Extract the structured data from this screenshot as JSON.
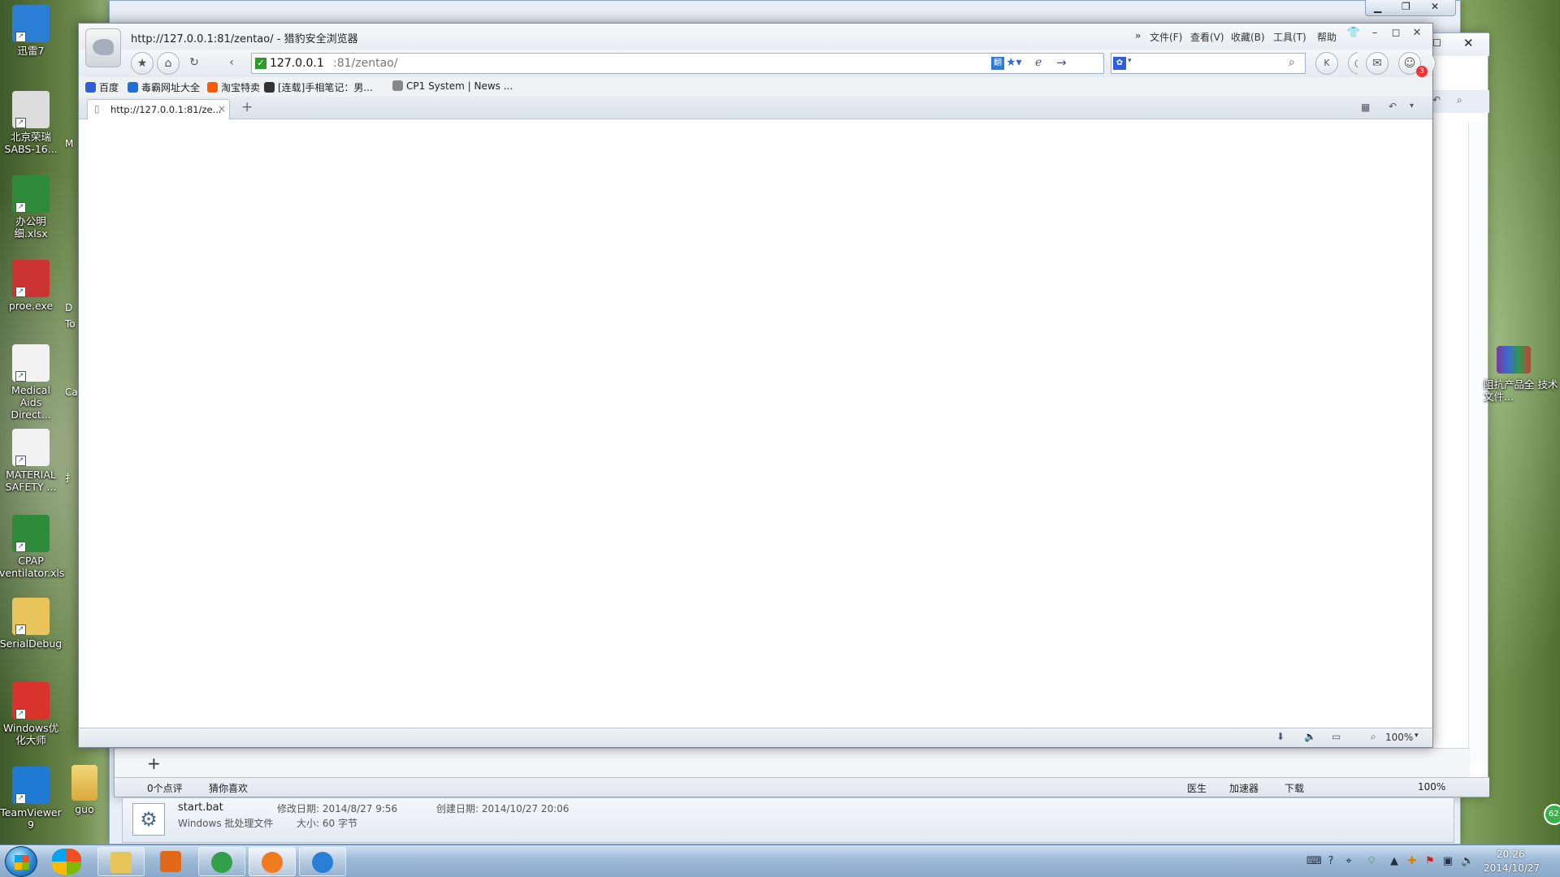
{
  "desktop": {
    "icons": [
      {
        "label": "迅雷7",
        "icon": "thunder-bird-icon",
        "color": "#2a7fd4"
      },
      {
        "label": "北京荣瑞 SABS-16...",
        "icon": "device-doc-icon",
        "color": "#ddd"
      },
      {
        "label": "办公明细.xlsx",
        "icon": "excel-file-icon",
        "color": "#2e8b3a"
      },
      {
        "label": "proe.exe",
        "icon": "proe-app-icon",
        "color": "#c33"
      },
      {
        "label": "Medical Aids Direct...",
        "icon": "pdf-document-icon",
        "color": "#f2f2f2"
      },
      {
        "label": "MATERIAL SAFETY ...",
        "icon": "pdf-document-icon",
        "color": "#f2f2f2"
      },
      {
        "label": "CPAP ventilator.xls",
        "icon": "excel-file-icon",
        "color": "#2e8b3a"
      },
      {
        "label": "SerialDebug",
        "icon": "folder-icon",
        "color": "#e8c45a"
      },
      {
        "label": "Windows优化大师",
        "icon": "windows-optimizer-icon",
        "color": "#d9332b"
      },
      {
        "label": "TeamViewer 9",
        "icon": "teamviewer-icon",
        "color": "#1f7bd4"
      }
    ],
    "partial_labels": [
      "M",
      "D",
      "To",
      "Ca",
      "扌"
    ],
    "guo_label": "guo",
    "right_icon_label": "阻抗产品全 技术文件..."
  },
  "browser": {
    "window_title": "http://127.0.0.1:81/zentao/ - 猎豹安全浏览器",
    "menu": [
      "文件(F)",
      "查看(V)",
      "收藏(B)",
      "工具(T)",
      "帮助"
    ],
    "menu_chevron": "»",
    "address_host": "127.0.0.1",
    "address_rest": ":81/zentao/",
    "favorites": [
      {
        "label": "百度",
        "icon": "baidu-paw-icon",
        "color": "#2e5fd8"
      },
      {
        "label": "毒霸网址大全",
        "icon": "k-circle-icon",
        "color": "#1e6fd6"
      },
      {
        "label": "淘宝特卖",
        "icon": "taobao-icon",
        "color": "#ff5a00"
      },
      {
        "label": "[连载]手相笔记：男...",
        "icon": "face-icon",
        "color": "#333"
      },
      {
        "label": "CP1 System | News ...",
        "icon": "page-icon",
        "color": "#888"
      }
    ],
    "tab_label": "http://127.0.0.1:81/ze...",
    "zoom": "100%",
    "notify_badge": "3"
  },
  "back_window": {
    "status_items": [
      "0个点评",
      "猜你喜欢"
    ],
    "right_status": [
      "医生",
      "加速器",
      "下载",
      "100%"
    ],
    "file": {
      "name": "start.bat",
      "type": "Windows 批处理文件",
      "modified": "修改日期: 2014/8/27 9:56",
      "size": "大小: 60 字节",
      "created": "创建日期: 2014/10/27 20:06"
    }
  },
  "taskbar": {
    "time": "20:26",
    "date": "2014/10/27",
    "pinned": [
      {
        "name": "start-orb",
        "color": "#2a9a3a"
      },
      {
        "name": "windows-flag-icon",
        "color": "#e45a2a"
      },
      {
        "name": "explorer-folder-icon",
        "color": "#e8c45a"
      },
      {
        "name": "media-player-icon",
        "color": "#e06a1a"
      },
      {
        "name": "ie-browser-icon",
        "color": "#32a04a"
      },
      {
        "name": "liebao-browser-icon",
        "color": "#f07a20"
      },
      {
        "name": "globe-browser-icon",
        "color": "#2b7ed6"
      }
    ],
    "tray_badge": "62"
  }
}
